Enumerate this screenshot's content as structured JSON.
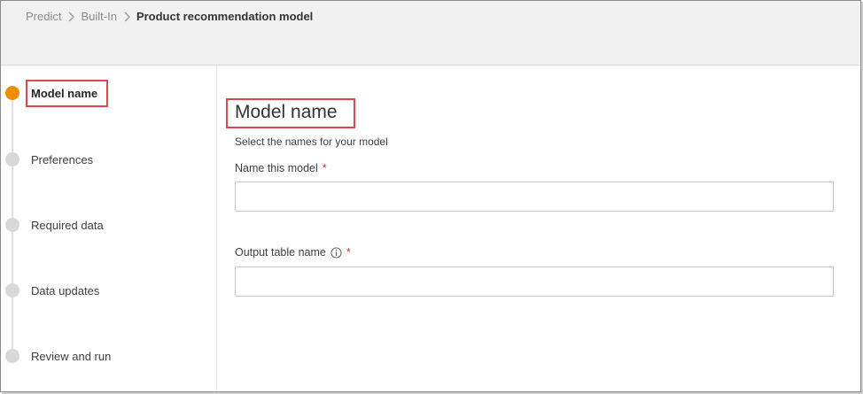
{
  "breadcrumb": {
    "items": [
      "Predict",
      "Built-In"
    ],
    "current": "Product recommendation model"
  },
  "steps": [
    {
      "label": "Model name",
      "active": true
    },
    {
      "label": "Preferences",
      "active": false
    },
    {
      "label": "Required data",
      "active": false
    },
    {
      "label": "Data updates",
      "active": false
    },
    {
      "label": "Review and run",
      "active": false
    }
  ],
  "main": {
    "title": "Model name",
    "subtitle": "Select the names for your model",
    "model_name_label": "Name this model",
    "model_name_value": "",
    "output_table_label": "Output table name",
    "output_table_value": "",
    "required_marker": "*"
  },
  "colors": {
    "active_step": "#f28c00",
    "inactive_step": "#d8d8d8",
    "highlight_box": "#e0474c",
    "required": "#d0302f"
  }
}
